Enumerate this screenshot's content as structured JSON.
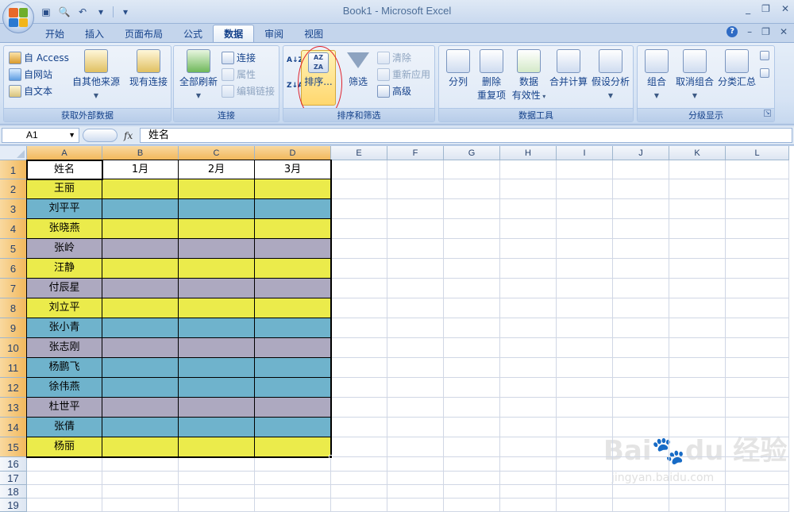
{
  "window": {
    "title": "Book1 - Microsoft Excel",
    "minimize": "_",
    "restore": "❐",
    "close": "✕"
  },
  "qat": {
    "save_icon": "save-icon",
    "print_preview_icon": "print-preview-icon",
    "undo_icon": "undo-icon",
    "customize": "▾"
  },
  "tabs": [
    "开始",
    "插入",
    "页面布局",
    "公式",
    "数据",
    "审阅",
    "视图"
  ],
  "active_tab": "数据",
  "ribbon": {
    "external_data": {
      "label": "获取外部数据",
      "access": "自 Access",
      "web": "自网站",
      "text": "自文本",
      "other": "自其他来源",
      "existing": "现有连接"
    },
    "connections": {
      "label": "连接",
      "refresh_all": "全部刷新",
      "connections": "连接",
      "properties": "属性",
      "edit_links": "编辑链接"
    },
    "sort_filter": {
      "label": "排序和筛选",
      "sort_az": "A↓Z",
      "sort_za": "Z↓A",
      "sort": "排序...",
      "filter": "筛选",
      "clear": "清除",
      "reapply": "重新应用",
      "advanced": "高级"
    },
    "data_tools": {
      "label": "数据工具",
      "text_to_columns": "分列",
      "remove_dup_1": "删除",
      "remove_dup_2": "重复项",
      "validation_1": "数据",
      "validation_2": "有效性",
      "consolidate": "合并计算",
      "whatif": "假设分析"
    },
    "outline": {
      "label": "分级显示",
      "group": "组合",
      "ungroup": "取消组合",
      "subtotal": "分类汇总"
    }
  },
  "formula_bar": {
    "name_box": "A1",
    "fx": "fx",
    "value": "姓名"
  },
  "columns": [
    "A",
    "B",
    "C",
    "D",
    "E",
    "F",
    "G",
    "H",
    "I",
    "J",
    "K",
    "L"
  ],
  "rows": [
    "1",
    "2",
    "3",
    "4",
    "5",
    "6",
    "7",
    "8",
    "9",
    "10",
    "11",
    "12",
    "13",
    "14",
    "15",
    "16",
    "17",
    "18",
    "19"
  ],
  "table": {
    "headers": [
      "姓名",
      "1月",
      "2月",
      "3月"
    ],
    "names": [
      "王丽",
      "刘平平",
      "张晓燕",
      "张岭",
      "汪静",
      "付辰星",
      "刘立平",
      "张小青",
      "张志刚",
      "杨鹏飞",
      "徐伟燕",
      "杜世平",
      "张倩",
      "杨丽"
    ],
    "row_colors": [
      "yellow",
      "blue",
      "yellow",
      "purple",
      "yellow",
      "purple",
      "yellow",
      "blue",
      "purple",
      "blue",
      "blue",
      "purple",
      "blue",
      "yellow"
    ]
  },
  "colors": {
    "yellow": "#ebeb4b",
    "blue": "#6fb3cc",
    "purple": "#ada9c0",
    "accent": "#15428b",
    "highlight": "#e0202a"
  },
  "watermark": {
    "brand": "Bai du 经验",
    "url": "jingyan.baidu.com"
  }
}
